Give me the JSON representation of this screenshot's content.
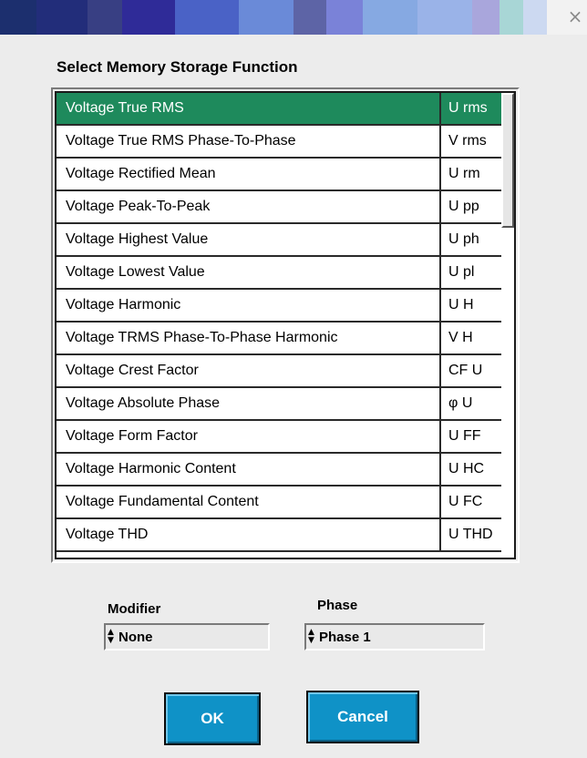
{
  "colors": {
    "selection": "#1e8a5c",
    "button": "#0f92c7",
    "title_strip": [
      "#1c2f6e",
      "#222d7a",
      "#383f83",
      "#2f2b98",
      "#4a62c6",
      "#6a8ad8",
      "#5d64a6",
      "#7a82d8",
      "#86a9e2",
      "#9ab3e8",
      "#a9a6dc",
      "#a8d6d6",
      "#ccd9f1"
    ]
  },
  "dialog": {
    "close_icon": "×",
    "heading": "Select Memory Storage Function"
  },
  "functions": [
    {
      "name": "Voltage True RMS",
      "abbr": "U rms",
      "selected": true
    },
    {
      "name": "Voltage True RMS Phase-To-Phase",
      "abbr": "V rms"
    },
    {
      "name": "Voltage Rectified Mean",
      "abbr": "U rm"
    },
    {
      "name": "Voltage Peak-To-Peak",
      "abbr": "U pp"
    },
    {
      "name": "Voltage Highest Value",
      "abbr": "U ph"
    },
    {
      "name": "Voltage Lowest Value",
      "abbr": "U pl"
    },
    {
      "name": "Voltage Harmonic",
      "abbr": "U H"
    },
    {
      "name": "Voltage TRMS Phase-To-Phase Harmonic",
      "abbr": "V H"
    },
    {
      "name": "Voltage Crest Factor",
      "abbr": "CF U"
    },
    {
      "name": "Voltage Absolute Phase",
      "abbr": "φ U"
    },
    {
      "name": "Voltage Form Factor",
      "abbr": "U FF"
    },
    {
      "name": "Voltage Harmonic Content",
      "abbr": "U HC"
    },
    {
      "name": "Voltage Fundamental Content",
      "abbr": "U FC"
    },
    {
      "name": "Voltage THD",
      "abbr": "U THD"
    }
  ],
  "modifier": {
    "label": "Modifier",
    "value": "None",
    "spin_icon": "▲▼"
  },
  "phase": {
    "label": "Phase",
    "value": "Phase 1",
    "spin_icon": "▲▼"
  },
  "buttons": {
    "ok": "OK",
    "cancel": "Cancel"
  }
}
